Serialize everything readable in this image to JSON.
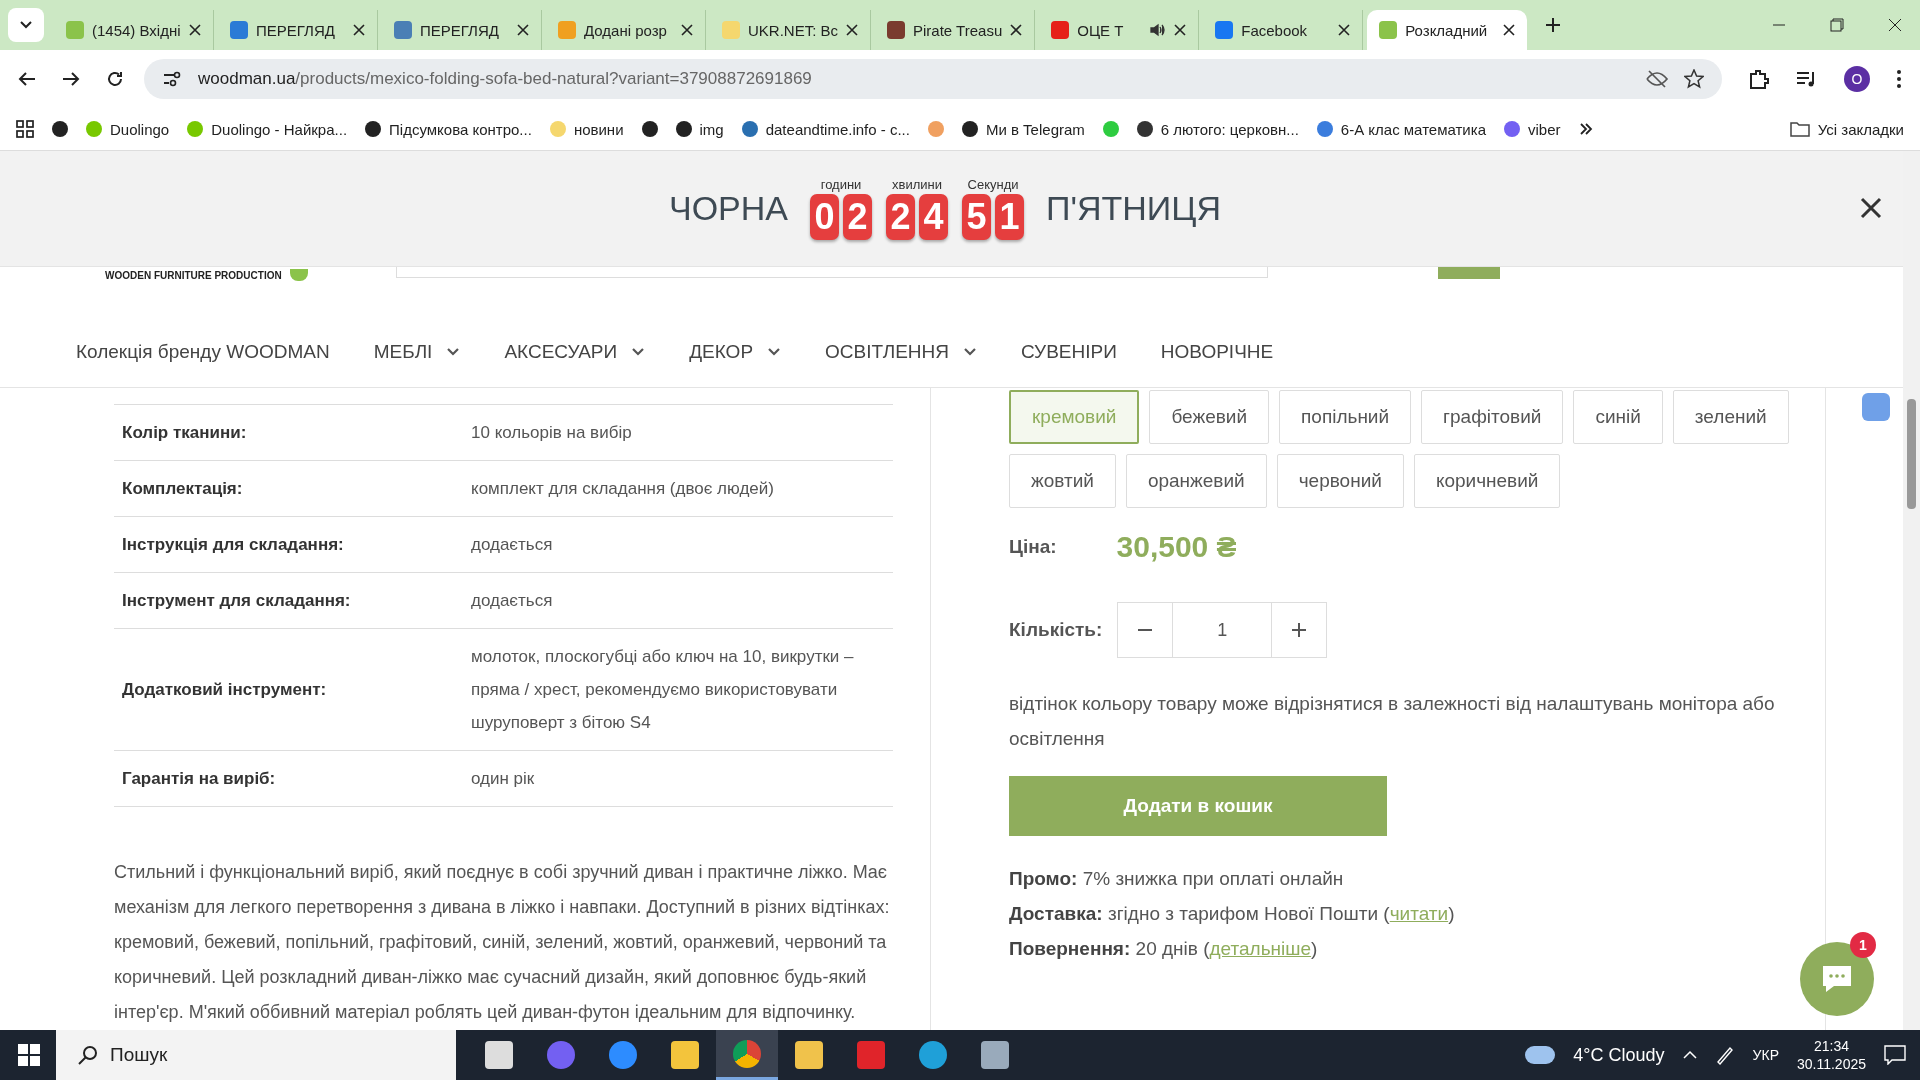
{
  "browser": {
    "tabs": [
      {
        "title": "(1454) Вхідні",
        "kind": "mail",
        "selected": false,
        "audio": false
      },
      {
        "title": "ПЕРЕГЛЯД",
        "kind": "doc",
        "selected": false,
        "audio": false
      },
      {
        "title": "ПЕРЕГЛЯД",
        "kind": "globe",
        "selected": false,
        "audio": false
      },
      {
        "title": "Додані розр",
        "kind": "bell",
        "selected": false,
        "audio": false
      },
      {
        "title": "UKR.NET: Вс",
        "kind": "ukr",
        "selected": false,
        "audio": false
      },
      {
        "title": "Pirate Treasu",
        "kind": "pixel",
        "selected": false,
        "audio": false
      },
      {
        "title": "ОЦЕ Т",
        "kind": "video",
        "selected": false,
        "audio": true
      },
      {
        "title": "Facebook",
        "kind": "facebook",
        "selected": false,
        "audio": false
      },
      {
        "title": "Розкладний",
        "kind": "leaf",
        "selected": true,
        "audio": false
      }
    ],
    "address": {
      "domain": "woodman.ua",
      "path": "/products/mexico-folding-sofa-bed-natural?variant=37908872691869"
    },
    "profile_initial": "O",
    "bookmarks": [
      {
        "kind": "globe"
      },
      {
        "label": "Duolingo",
        "kind": "owl"
      },
      {
        "label": "Duolingo - Найкра...",
        "kind": "owl"
      },
      {
        "label": "Підсумкова контро...",
        "kind": "dark"
      },
      {
        "label": "новини",
        "kind": "ukr"
      },
      {
        "kind": "globe"
      },
      {
        "label": "img",
        "kind": "globe"
      },
      {
        "label": "dateandtime.info - с...",
        "kind": "d"
      },
      {
        "kind": "stripe"
      },
      {
        "label": "Ми в Telegram",
        "kind": "globe"
      },
      {
        "kind": "green"
      },
      {
        "label": "6 лютого: церковн...",
        "kind": "list"
      },
      {
        "label": "6-А клас математика",
        "kind": "person"
      },
      {
        "label": "viber",
        "kind": "viber"
      }
    ],
    "all_bookmarks": "Усі закладки"
  },
  "countdown": {
    "left_text": "ЧОРНА",
    "right_text": "П'ЯТНИЦЯ",
    "units": [
      {
        "label": "години",
        "digits": [
          "0",
          "2"
        ]
      },
      {
        "label": "хвилини",
        "digits": [
          "2",
          "4"
        ]
      },
      {
        "label": "Секунди",
        "digits": [
          "5",
          "1"
        ]
      }
    ]
  },
  "header": {
    "logo_caption": "WOODEN FURNITURE PRODUCTION"
  },
  "nav": [
    {
      "label": "Колекція бренду WOODMAN",
      "dropdown": false
    },
    {
      "label": "МЕБЛІ",
      "dropdown": true
    },
    {
      "label": "АКСЕСУАРИ",
      "dropdown": true
    },
    {
      "label": "ДЕКОР",
      "dropdown": true
    },
    {
      "label": "ОСВІТЛЕННЯ",
      "dropdown": true
    },
    {
      "label": "СУВЕНІРИ",
      "dropdown": false
    },
    {
      "label": "НОВОРІЧНЕ",
      "dropdown": false
    }
  ],
  "specs": [
    {
      "label": "Колір тканини:",
      "value": "10 кольорів на вибір"
    },
    {
      "label": "Комплектація:",
      "value": "комплект для складання (двоє людей)"
    },
    {
      "label": "Інструкція для складання:",
      "value": "додається"
    },
    {
      "label": "Інструмент для складання:",
      "value": "додається"
    },
    {
      "label": "Додатковий інструмент:",
      "value": "молоток, плоскогубці або ключ на 10, викрутки – пряма / хрест, рекомендуємо використовувати шуруповерт з бітою S4"
    },
    {
      "label": "Гарантія на виріб:",
      "value": "один рік"
    }
  ],
  "description": "Стильний і функціональний виріб, який поєднує в собі зручний диван і практичне ліжко. Має механізм для легкого перетворення з дивана в ліжко і навпаки. Доступний в різних відтінках: кремовий, бежевий, попільний, графітовий, синій, зелений, жовтий, оранжевий, червоний та коричневий. Цей розкладний диван-ліжко має сучасний дизайн, який доповнює будь-який інтер'єр. М'який оббивний матеріал роблять цей диван-футон ідеальним для відпочинку.",
  "colors": [
    {
      "label": "кремовий",
      "selected": true
    },
    {
      "label": "бежевий",
      "selected": false
    },
    {
      "label": "попільний",
      "selected": false
    },
    {
      "label": "графітовий",
      "selected": false
    },
    {
      "label": "синій",
      "selected": false
    },
    {
      "label": "зелений",
      "selected": false
    },
    {
      "label": "жовтий",
      "selected": false
    },
    {
      "label": "оранжевий",
      "selected": false
    },
    {
      "label": "червоний",
      "selected": false
    },
    {
      "label": "коричневий",
      "selected": false
    }
  ],
  "price": {
    "label": "Ціна:",
    "value": "30,500 ₴"
  },
  "quantity": {
    "label": "Кількість:",
    "value": "1"
  },
  "note": "відтінок кольору товару може відрізнятися в залежності від налаштувань монітора або освітлення",
  "add_button": "Додати в кошик",
  "info": [
    {
      "label": "Промо:",
      "text": "7% знижка при оплаті онлайн"
    },
    {
      "label": "Доставка:",
      "text": "згідно з тарифом Нової Пошти (",
      "link": "читати",
      "suffix": ")"
    },
    {
      "label": "Повернення:",
      "text": "20 днів (",
      "link": "детальніше",
      "suffix": ")"
    }
  ],
  "chat_badge": "1",
  "taskbar": {
    "search_placeholder": "Пошук",
    "weather": "4°C Cloudy",
    "language": "УКР",
    "time": "21:34",
    "date": "30.11.2025"
  }
}
